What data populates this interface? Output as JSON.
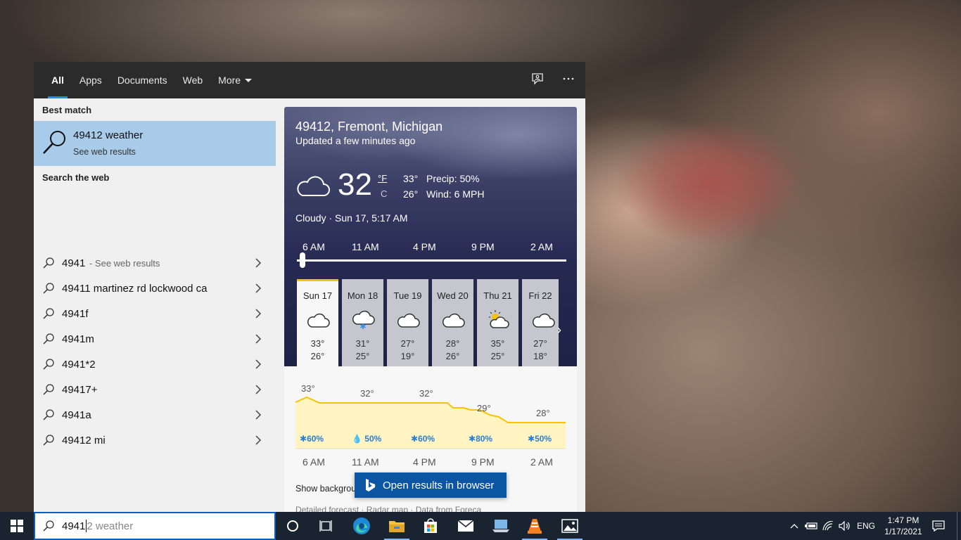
{
  "tabs": [
    {
      "label": "All",
      "active": true
    },
    {
      "label": "Apps"
    },
    {
      "label": "Documents"
    },
    {
      "label": "Web"
    },
    {
      "label": "More"
    }
  ],
  "header_icons": [
    "feedback-icon",
    "more-options-icon"
  ],
  "best_match": {
    "section": "Best match",
    "title": "49412 weather",
    "subtitle": "See web results"
  },
  "search_web": {
    "section": "Search the web",
    "items": [
      {
        "text": "4941",
        "suffix": " - See web results"
      },
      {
        "text": "49411 martinez rd lockwood ca"
      },
      {
        "text": "4941f"
      },
      {
        "text": "4941m"
      },
      {
        "text": "4941*2"
      },
      {
        "text": "49417+"
      },
      {
        "text": "4941a"
      },
      {
        "text": "49412 mi"
      }
    ]
  },
  "weather": {
    "location": "49412, Fremont, Michigan",
    "updated": "Updated a few minutes ago",
    "temp": "32",
    "unit_f": "°F",
    "unit_c": "C",
    "high": "33°",
    "low": "26°",
    "precip": "Precip: 50%",
    "wind": "Wind: 6 MPH",
    "condition": "Cloudy · Sun 17, 5:17 AM",
    "timeline_labels": [
      "6 AM",
      "11 AM",
      "4 PM",
      "9 PM",
      "2 AM"
    ],
    "days": [
      {
        "name": "Sun 17",
        "icon": "cloud-icon",
        "high": "33°",
        "low": "26°",
        "selected": true
      },
      {
        "name": "Mon 18",
        "icon": "snow-cloud-icon",
        "high": "31°",
        "low": "25°"
      },
      {
        "name": "Tue 19",
        "icon": "cloud-icon",
        "high": "27°",
        "low": "19°"
      },
      {
        "name": "Wed 20",
        "icon": "cloud-icon",
        "high": "28°",
        "low": "26°"
      },
      {
        "name": "Thu 21",
        "icon": "partly-sunny-icon",
        "high": "35°",
        "low": "25°"
      },
      {
        "name": "Fri 22",
        "icon": "cloud-icon",
        "high": "27°",
        "low": "18°"
      }
    ],
    "hourly": {
      "x_labels": [
        "6 AM",
        "11 AM",
        "4 PM",
        "9 PM",
        "2 AM"
      ],
      "temps": [
        "33°",
        "32°",
        "32°",
        "29°",
        "28°"
      ],
      "precip": [
        {
          "icon": "snowflake-icon",
          "value": "60%"
        },
        {
          "icon": "raindrop-icon",
          "value": "50%"
        },
        {
          "icon": "snowflake-icon",
          "value": "60%"
        },
        {
          "icon": "snowflake-icon",
          "value": "80%"
        },
        {
          "icon": "snowflake-icon",
          "value": "50%"
        }
      ]
    },
    "show_background": "Show background",
    "footer": [
      "Detailed forecast",
      "Radar map",
      "Data from Foreca"
    ],
    "open_browser": "Open results in browser"
  },
  "taskbar": {
    "search_typed": "4941",
    "search_ghost": "2 weather",
    "apps": [
      "cortana-icon",
      "task-view-icon",
      "edge-icon",
      "file-explorer-icon",
      "store-icon",
      "mail-icon",
      "laptop-icon",
      "vlc-icon",
      "photos-icon"
    ],
    "lang": "ENG",
    "time": "1:47 PM",
    "date": "1/17/2021"
  },
  "colors": {
    "accent": "#2d8ae0",
    "best_match_bg": "#a8cbea",
    "open_button": "#0c55a3",
    "chart_line": "#f5c400",
    "precip_text": "#2a7dd1"
  }
}
